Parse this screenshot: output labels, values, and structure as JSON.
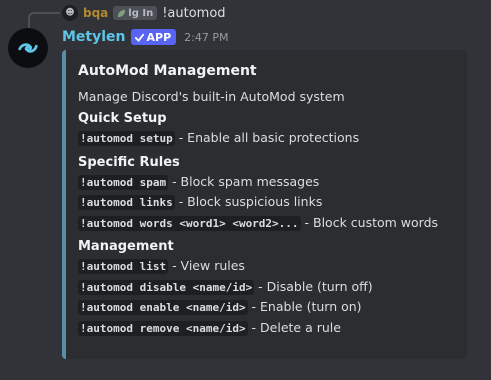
{
  "reply": {
    "avatar_glyph": "☻",
    "username": "bqa",
    "tag_icon": "leaf-icon",
    "tag": "lg In",
    "text": "!automod"
  },
  "message": {
    "avatar_icon": "swirl-logo-icon",
    "username": "Metylen",
    "badge": "APP",
    "timestamp": "2:47 PM"
  },
  "embed": {
    "accent_color": "#5a8fa8",
    "title": "AutoMod Management",
    "description": "Manage Discord's built-in AutoMod system",
    "sections": [
      {
        "name": "Quick Setup",
        "lines": [
          {
            "cmd": "!automod setup",
            "text": " - Enable all basic protections"
          }
        ]
      },
      {
        "name": "Specific Rules",
        "lines": [
          {
            "cmd": "!automod spam",
            "text": " - Block spam messages"
          },
          {
            "cmd": "!automod links",
            "text": " - Block suspicious links"
          },
          {
            "cmd": "!automod words <word1> <word2>...",
            "text": " - Block custom words"
          }
        ]
      },
      {
        "name": "Management",
        "lines": [
          {
            "cmd": "!automod list",
            "text": " - View rules"
          },
          {
            "cmd": "!automod disable <name/id>",
            "text": " - Disable (turn off)"
          },
          {
            "cmd": "!automod enable <name/id>",
            "text": " - Enable (turn on)"
          },
          {
            "cmd": "!automod remove <name/id>",
            "text": " - Delete a rule"
          }
        ]
      }
    ]
  },
  "colors": {
    "background": "#313338",
    "embed_background": "#2b2d31",
    "username": "#5ec6e8",
    "app_badge": "#5865f2"
  }
}
